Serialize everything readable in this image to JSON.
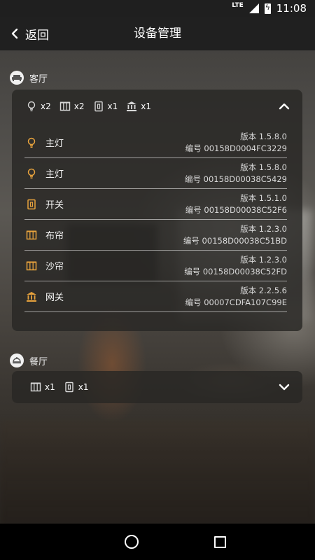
{
  "status_bar": {
    "network": "LTE",
    "time": "11:08"
  },
  "header": {
    "back_label": "返回",
    "title": "设备管理"
  },
  "colors": {
    "accent": "#e8a33d",
    "icon_gray": "#d8d8d8"
  },
  "rooms": [
    {
      "name": "客厅",
      "icon": "sofa-icon",
      "expanded": true,
      "summary": [
        {
          "icon": "bulb-icon",
          "count": "x2"
        },
        {
          "icon": "curtain-icon",
          "count": "x2"
        },
        {
          "icon": "switch-icon",
          "count": "x1"
        },
        {
          "icon": "gateway-icon",
          "count": "x1"
        }
      ],
      "devices": [
        {
          "icon": "bulb-icon",
          "name": "主灯",
          "version": "版本 1.5.8.0",
          "serial": "编号 00158D0004FC3229"
        },
        {
          "icon": "bulb-icon",
          "name": "主灯",
          "version": "版本 1.5.8.0",
          "serial": "编号 00158D00038C5429"
        },
        {
          "icon": "switch-icon",
          "name": "开关",
          "version": "版本 1.5.1.0",
          "serial": "编号 00158D00038C52F6"
        },
        {
          "icon": "curtain-icon",
          "name": "布帘",
          "version": "版本 1.2.3.0",
          "serial": "编号 00158D00038C51BD"
        },
        {
          "icon": "curtain-icon",
          "name": "沙帘",
          "version": "版本 1.2.3.0",
          "serial": "编号 00158D00038C52FD"
        },
        {
          "icon": "gateway-icon",
          "name": "网关",
          "version": "版本 2.2.5.6",
          "serial": "编号 00007CDFA107C99E"
        }
      ]
    },
    {
      "name": "餐厅",
      "icon": "dining-icon",
      "expanded": false,
      "summary": [
        {
          "icon": "curtain-icon",
          "count": "x1"
        },
        {
          "icon": "switch-icon",
          "count": "x1"
        }
      ]
    }
  ]
}
